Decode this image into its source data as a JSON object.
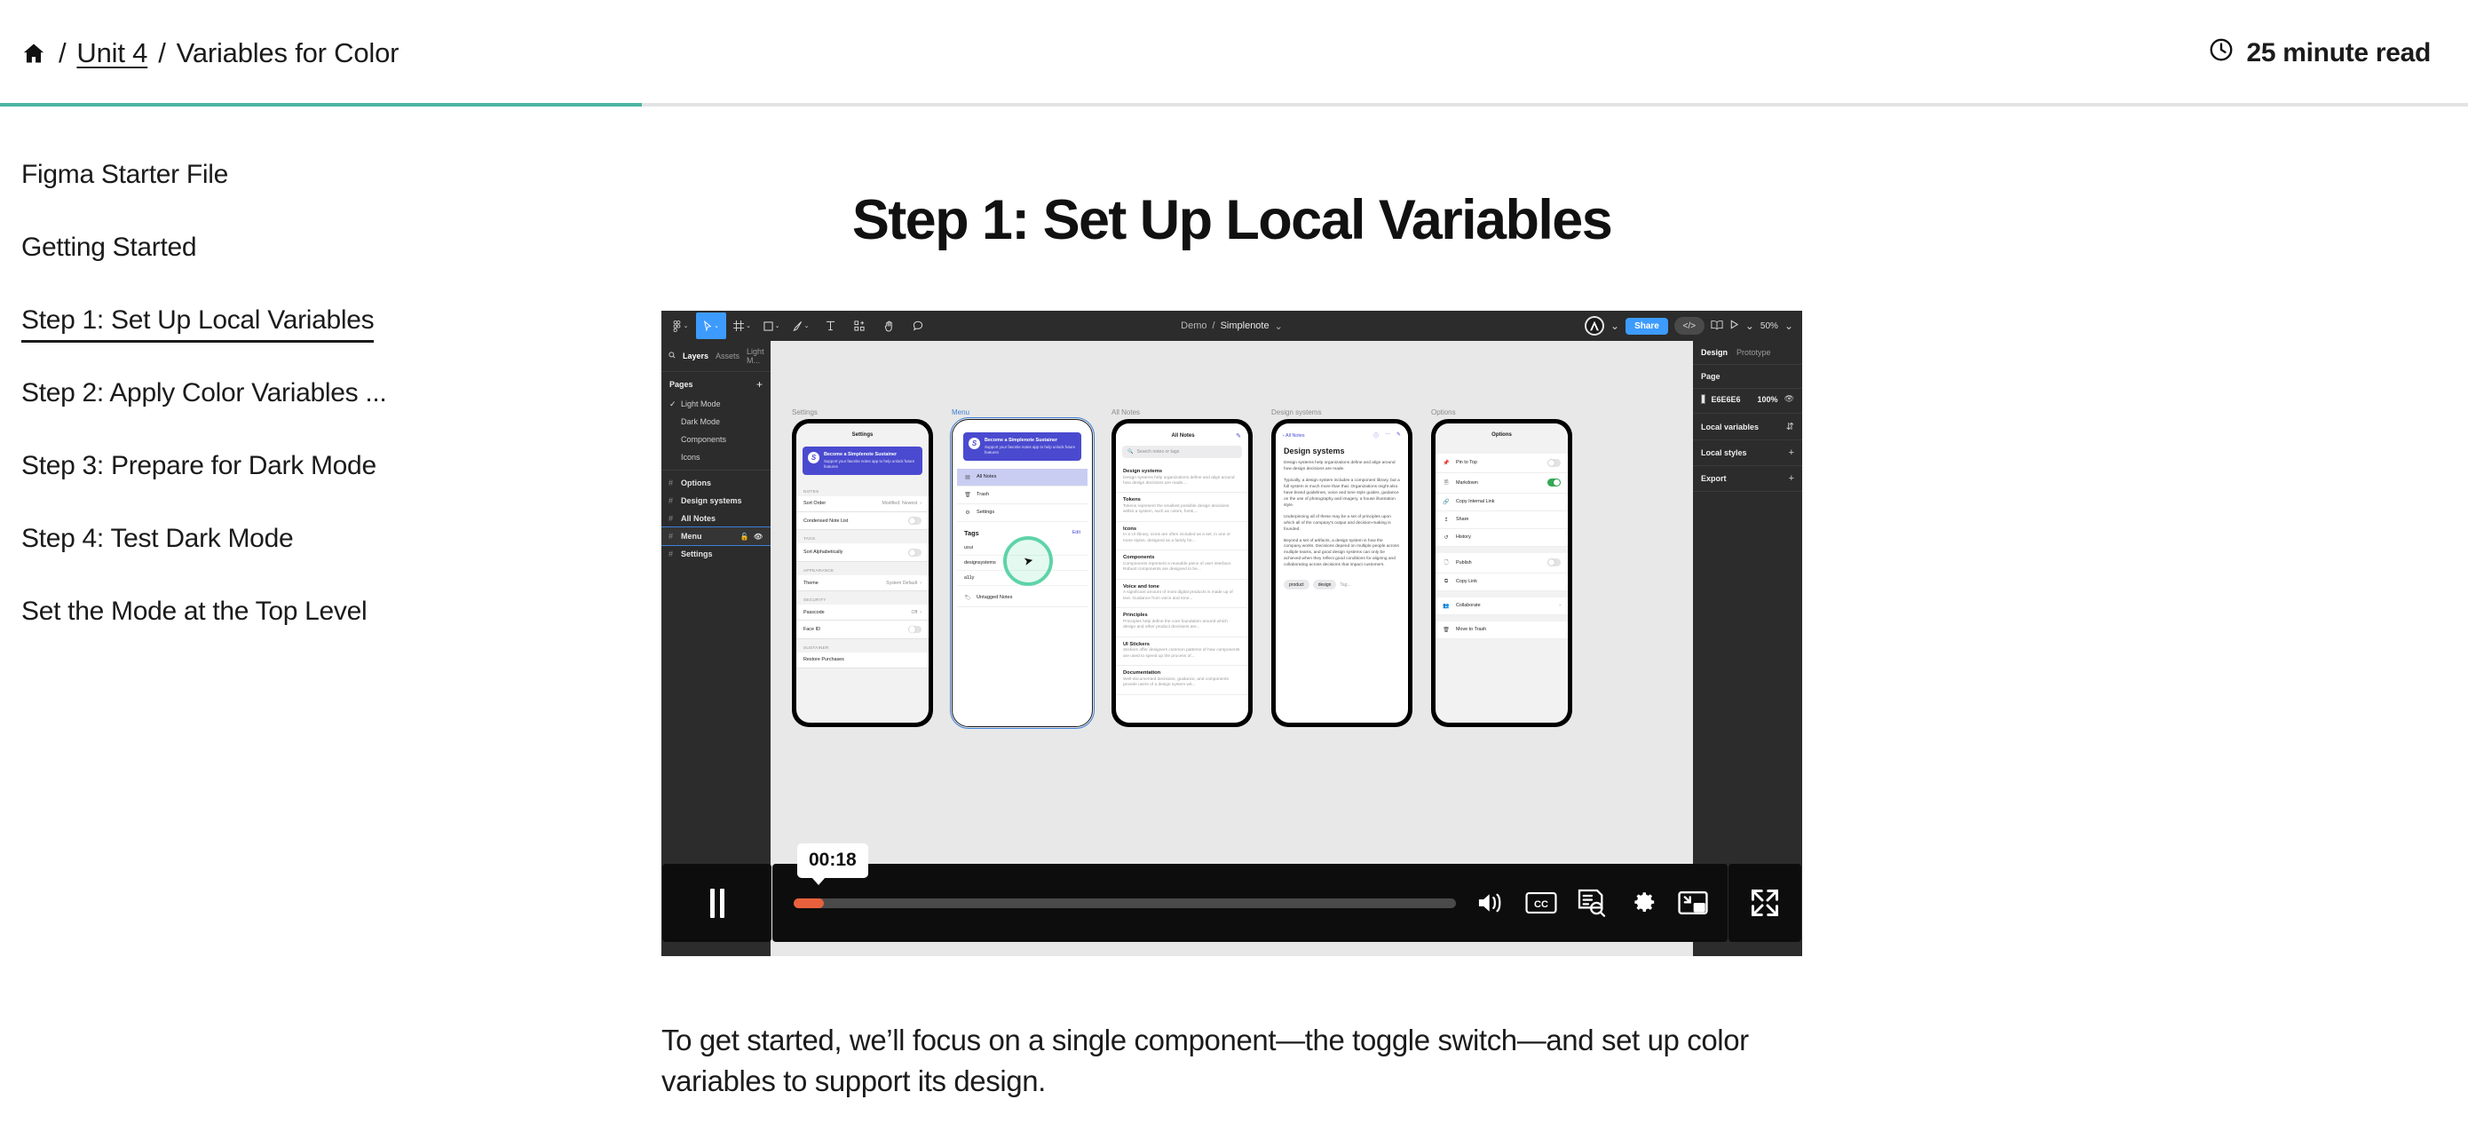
{
  "header": {
    "home_icon": "home-icon",
    "sep": "/",
    "unit_link": "Unit 4",
    "current": "Variables for Color",
    "read_time": "25 minute read",
    "clock_icon": "clock-icon",
    "progress_percent": 26,
    "accent_color": "#4cb5a2"
  },
  "sidebar": {
    "items": [
      {
        "label": "Figma Starter File",
        "active": false
      },
      {
        "label": "Getting Started",
        "active": false
      },
      {
        "label": "Step 1: Set Up Local Variables",
        "active": true
      },
      {
        "label": "Step 2: Apply Color Variables ...",
        "active": false
      },
      {
        "label": "Step 3: Prepare for Dark Mode",
        "active": false
      },
      {
        "label": "Step 4: Test Dark Mode",
        "active": false
      },
      {
        "label": "Set the Mode at the Top Level",
        "active": false
      }
    ]
  },
  "main": {
    "title": "Step 1: Set Up Local Variables",
    "paragraph": "To get started, we’ll focus on a single component—the toggle switch—and set up color variables to support its design."
  },
  "player": {
    "state": "playing",
    "pause_label": "Pause",
    "current_time": "00:18",
    "progress_percent": 3.2,
    "progress_color": "#e8613c",
    "controls": [
      {
        "name": "volume-icon",
        "label": "Volume"
      },
      {
        "name": "captions-icon",
        "label": "CC"
      },
      {
        "name": "transcript-icon",
        "label": "Transcript"
      },
      {
        "name": "settings-gear-icon",
        "label": "Settings"
      },
      {
        "name": "picture-in-picture-icon",
        "label": "Picture in picture"
      },
      {
        "name": "fullscreen-icon",
        "label": "Fullscreen"
      }
    ]
  },
  "figma": {
    "document": {
      "project": "Demo",
      "sep": "/",
      "file": "Simplenote"
    },
    "zoom": "50%",
    "share_label": "Share",
    "toolbar_tools": [
      "figma-menu-icon",
      "move-tool-icon",
      "frame-tool-icon",
      "shape-tool-icon",
      "pen-tool-icon",
      "text-tool-icon",
      "components-tool-icon",
      "hand-tool-icon",
      "comment-tool-icon"
    ],
    "left_panel": {
      "tabs": [
        {
          "label": "Layers",
          "active": true
        },
        {
          "label": "Assets",
          "active": false
        }
      ],
      "page_selector": "Light M...",
      "pages_header": "Pages",
      "add_icon": "plus-icon",
      "pages": [
        {
          "label": "Light Mode",
          "checked": true
        },
        {
          "label": "Dark Mode",
          "checked": false
        },
        {
          "label": "Components",
          "checked": false
        },
        {
          "label": "Icons",
          "checked": false
        }
      ],
      "layers": [
        {
          "label": "Options",
          "selected": false
        },
        {
          "label": "Design systems",
          "selected": false
        },
        {
          "label": "All Notes",
          "selected": false
        },
        {
          "label": "Menu",
          "selected": true
        },
        {
          "label": "Settings",
          "selected": false
        }
      ]
    },
    "right_panel": {
      "tabs": [
        {
          "label": "Design",
          "active": true
        },
        {
          "label": "Prototype",
          "active": false
        }
      ],
      "page_section": "Page",
      "page_fill_hex": "E6E6E6",
      "page_fill_opacity": "100%",
      "sections": [
        {
          "label": "Local variables",
          "action": "sliders-icon"
        },
        {
          "label": "Local styles",
          "action": "plus-icon"
        },
        {
          "label": "Export",
          "action": "plus-icon"
        }
      ]
    },
    "frames": [
      {
        "label": "Settings",
        "selected": false
      },
      {
        "label": "Menu",
        "selected": true
      },
      {
        "label": "All Notes",
        "selected": false
      },
      {
        "label": "Design systems",
        "selected": false
      },
      {
        "label": "Options",
        "selected": false
      }
    ],
    "screens": {
      "settings": {
        "title": "Settings",
        "promo_title": "Become a Simplenote Sustainer",
        "promo_body": "Support your favorite notes app to help unlock future features",
        "groups": [
          {
            "label": "NOTES",
            "rows": [
              {
                "label": "Sort Order",
                "value": "Modified: Newest",
                "type": "disclosure"
              },
              {
                "label": "Condensed Note List",
                "value": "",
                "type": "toggle",
                "on": false
              }
            ]
          },
          {
            "label": "TAGS",
            "rows": [
              {
                "label": "Sort Alphabetically",
                "value": "",
                "type": "toggle",
                "on": false
              }
            ]
          },
          {
            "label": "APPEARANCE",
            "rows": [
              {
                "label": "Theme",
                "value": "System Default",
                "type": "disclosure"
              }
            ]
          },
          {
            "label": "SECURITY",
            "rows": [
              {
                "label": "Passcode",
                "value": "Off",
                "type": "disclosure"
              },
              {
                "label": "Face ID",
                "value": "",
                "type": "toggle",
                "on": false
              }
            ]
          },
          {
            "label": "SUSTAINER",
            "rows": [
              {
                "label": "Restore Purchases",
                "value": "",
                "type": "plain"
              }
            ]
          }
        ]
      },
      "menu": {
        "promo_title": "Become a Simplenote Sustainer",
        "promo_body": "Support your favorite notes app to help unlock future features",
        "items": [
          {
            "label": "All Notes",
            "icon": "notes-icon",
            "active": true
          },
          {
            "label": "Trash",
            "icon": "trash-icon",
            "active": false
          },
          {
            "label": "Settings",
            "icon": "gear-icon",
            "active": false
          }
        ],
        "tags_header": "Tags",
        "edit_label": "Edit",
        "tags": [
          "uxui",
          "designsystems",
          "a11y"
        ],
        "untagged_label": "Untagged Notes",
        "untagged_icon": "tag-icon"
      },
      "all_notes": {
        "title": "All Notes",
        "compose_icon": "compose-icon",
        "search_placeholder": "Search notes or tags",
        "search_icon": "search-icon",
        "notes": [
          {
            "title": "Design systems",
            "excerpt": "Design systems help organizations define and align around how design decisions are made...."
          },
          {
            "title": "Tokens",
            "excerpt": "Tokens represent the smallest possible design decisions within a system, such as colors, fonts,..."
          },
          {
            "title": "Icons",
            "excerpt": "In a UI library, icons are often included as a set, in one or more styles, designed as a family for..."
          },
          {
            "title": "Components",
            "excerpt": "Components represent a reusable piece of user interface. Robust components are designed to be..."
          },
          {
            "title": "Voice and tone",
            "excerpt": "A significant amount of most digital products is made up of text. Guidance from voice and tone..."
          },
          {
            "title": "Principles",
            "excerpt": "Principles help define the core foundation around which design and other product decisions are..."
          },
          {
            "title": "UI Stickers",
            "excerpt": "Stickers offer designers common patterns of how components are used to speed up the process of..."
          },
          {
            "title": "Documentation",
            "excerpt": "Well-documented decisions, guidance, and components provide users of a design system wit..."
          }
        ]
      },
      "note_detail": {
        "back_label": "All Notes",
        "icons": [
          "info-icon",
          "more-icon",
          "compose-icon"
        ],
        "title": "Design systems",
        "paragraphs": [
          "Design systems help organizations define and align around how design decisions are made.",
          "Typically, a design system includes a component library, but a full system is much more than that. Organizations might also have brand guidelines, voice and tone style guides, guidance on the use of photography and imagery, a house illustration style.",
          "Underpinning all of these may be a set of principles upon which all of the company's output and decision-making is founded.",
          "Beyond a set of artifacts, a design system is how the company works. Decisions depend on multiple people across multiple teams, and good design systems can only be achieved when they reflect good conditions for aligning and collaborating across decisions that impact customers."
        ],
        "tags": [
          "product",
          "design"
        ],
        "tag_placeholder": "Tag..."
      },
      "options": {
        "title": "Options",
        "groups": [
          {
            "rows": [
              {
                "label": "Pin to Top",
                "icon": "pin-icon",
                "type": "toggle",
                "on": false
              },
              {
                "label": "Markdown",
                "icon": "markdown-icon",
                "type": "toggle",
                "on": true
              },
              {
                "label": "Copy Internal Link",
                "icon": "link-icon",
                "type": "plain"
              },
              {
                "label": "Share",
                "icon": "share-icon",
                "type": "plain"
              },
              {
                "label": "History",
                "icon": "history-icon",
                "type": "plain"
              }
            ]
          },
          {
            "rows": [
              {
                "label": "Publish",
                "icon": "publish-icon",
                "type": "toggle",
                "on": false
              },
              {
                "label": "Copy Link",
                "icon": "copy-link-icon",
                "type": "plain"
              }
            ]
          },
          {
            "rows": [
              {
                "label": "Collaborate",
                "icon": "people-icon",
                "type": "disclosure"
              }
            ]
          },
          {
            "rows": [
              {
                "label": "Move to Trash",
                "icon": "trash-icon",
                "type": "plain"
              }
            ]
          }
        ]
      }
    }
  }
}
